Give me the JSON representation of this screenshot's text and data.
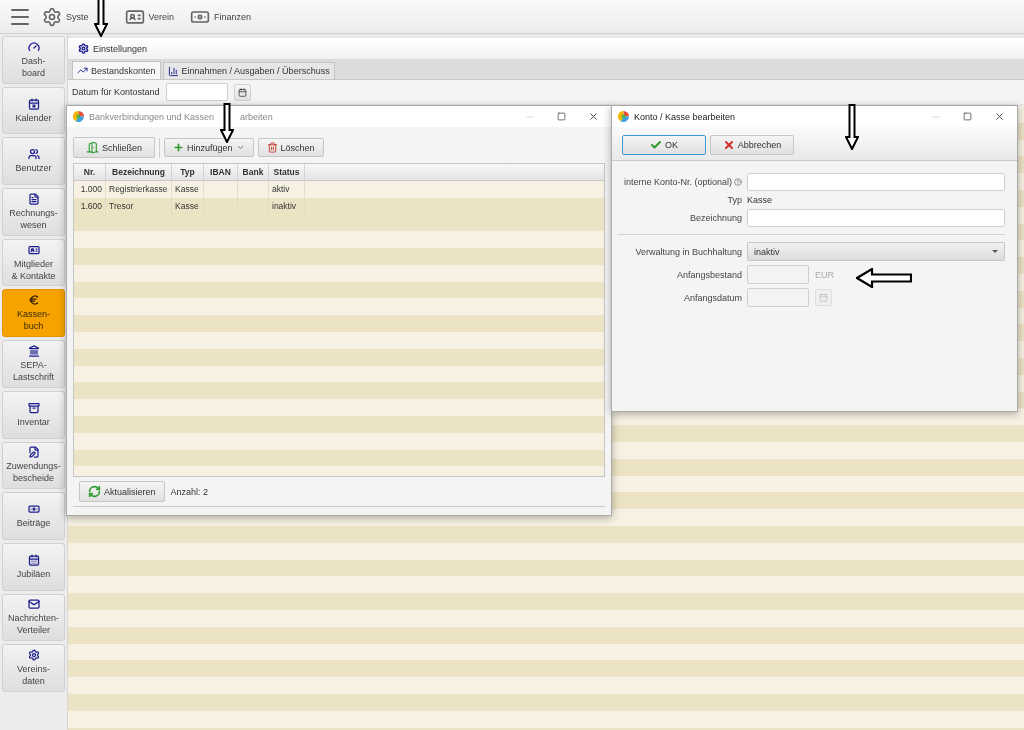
{
  "top_menu": {
    "items": [
      {
        "label": "Syste"
      },
      {
        "label": "Verein"
      },
      {
        "label": "Finanzen"
      }
    ]
  },
  "sidebar": {
    "items": [
      {
        "label": "Dash-\nboard",
        "selected": false
      },
      {
        "label": "Kalender",
        "selected": false
      },
      {
        "label": "Benutzer",
        "selected": false
      },
      {
        "label": "Rechnungs-\nwesen",
        "selected": false
      },
      {
        "label": "Mitglieder\n& Kontakte",
        "selected": false
      },
      {
        "label": "Kassen-\nbuch",
        "selected": true
      },
      {
        "label": "SEPA-\nLastschrift",
        "selected": false
      },
      {
        "label": "Inventar",
        "selected": false
      },
      {
        "label": "Zuwendungs-\nbescheide",
        "selected": false
      },
      {
        "label": "Beiträge",
        "selected": false
      },
      {
        "label": "Jubiläen",
        "selected": false
      },
      {
        "label": "Nachrichten-\nVerteiler",
        "selected": false
      },
      {
        "label": "Vereins-\ndaten",
        "selected": false
      }
    ]
  },
  "breadcrumb": "Einstellungen",
  "tabs": [
    {
      "label": "Bestandskonten",
      "selected": true
    },
    {
      "label": "Einnahmen / Ausgaben / Überschuss",
      "selected": false
    }
  ],
  "date_filter": {
    "label": "Datum für Kontostand"
  },
  "accounts_dialog": {
    "title": "Bankverbindungen und Kassen",
    "title_rest": "arbeiten",
    "buttons": [
      {
        "label": "Schließen",
        "kind": "plain"
      },
      {
        "label": "Hinzufügen",
        "kind": "menu"
      },
      {
        "label": "Löschen",
        "kind": "plain"
      }
    ],
    "table": {
      "columns": [
        "Nr.",
        "Bezeichnung",
        "Typ",
        "IBAN",
        "Bank",
        "Status"
      ],
      "rows": [
        {
          "nr": "1.000",
          "name": "Registrierkasse",
          "type": "Kasse",
          "status": "aktiv"
        },
        {
          "nr": "1.600",
          "name": "Tresor",
          "type": "Kasse",
          "status": "inaktiv"
        }
      ]
    },
    "refresh_button": "Aktualisieren",
    "count": "Anzahl: 2"
  },
  "edit_dialog": {
    "title": "Konto / Kasse bearbeiten",
    "buttons": [
      {
        "label": "OK",
        "focused": true
      },
      {
        "label": "Abbrechen",
        "focused": false
      }
    ],
    "fields": [
      {
        "kind": "input",
        "label": "interne Konto-Nr. (optional)",
        "help": true,
        "disabled": false
      },
      {
        "kind": "text",
        "label": "Typ",
        "value": "Kasse"
      },
      {
        "kind": "input",
        "label": "Bezeichnung",
        "help": false,
        "disabled": false
      },
      {
        "kind": "separator"
      },
      {
        "kind": "select",
        "label": "Verwaltung in Buchhaltung",
        "value": "inaktiv"
      },
      {
        "kind": "amount",
        "label": "Anfangsbestand",
        "unit": "EUR",
        "disabled": true
      },
      {
        "kind": "date",
        "label": "Anfangsdatum",
        "disabled": true
      }
    ]
  }
}
